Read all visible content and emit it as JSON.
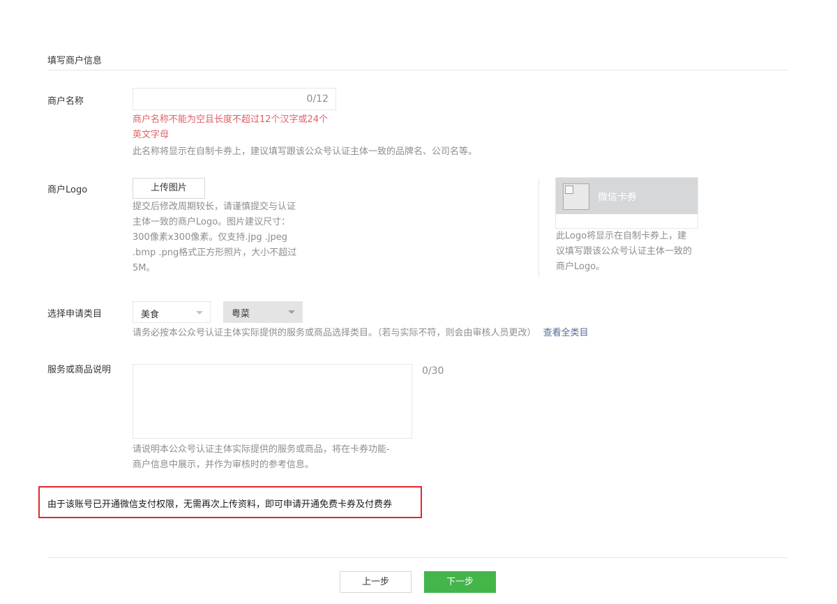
{
  "section": {
    "title": "填写商户信息"
  },
  "merchant_name": {
    "label": "商户名称",
    "value": "",
    "counter": "0/12",
    "error_line1": "商户名称不能为空且长度不超过12个汉字或24个",
    "error_line2": "英文字母",
    "hint": "此名称将显示在自制卡券上，建议填写跟该公众号认证主体一致的品牌名、公司名等。"
  },
  "logo": {
    "label": "商户Logo",
    "upload_label": "上传图片",
    "hint_lines": [
      "提交后修改周期较长，请谨慎提交与认证",
      "主体一致的商户Logo。图片建议尺寸：",
      "300像素x300像素。仅支持.jpg .jpeg",
      ".bmp .png格式正方形照片，大小不超过",
      "5M。"
    ],
    "preview_card_name": "微信卡券",
    "preview_hint_lines": [
      "此Logo将显示在自制卡券上，建",
      "议填写跟该公众号认证主体一致的",
      "商户Logo。"
    ]
  },
  "category": {
    "label": "选择申请类目",
    "primary_selected": "美食",
    "secondary_selected": "粤菜",
    "hint": "请务必按本公众号认证主体实际提供的服务或商品选择类目。（若与实际不符，则会由审核人员更改）",
    "link": "查看全类目"
  },
  "description": {
    "label": "服务或商品说明",
    "value": "",
    "counter": "0/30",
    "hint_line1": "请说明本公众号认证主体实际提供的服务或商品，将在卡券功能-",
    "hint_line2": "商户信息中展示，并作为审核时的参考信息。"
  },
  "notice": {
    "text": "由于该账号已开通微信支付权限，无需再次上传资料，即可申请开通免费卡券及付费券"
  },
  "footer": {
    "prev_label": "上一步",
    "next_label": "下一步"
  },
  "colors": {
    "accent_green": "#44b549",
    "error_red": "#e15f63",
    "link_blue": "#576b95",
    "notice_border": "#e0282e"
  }
}
